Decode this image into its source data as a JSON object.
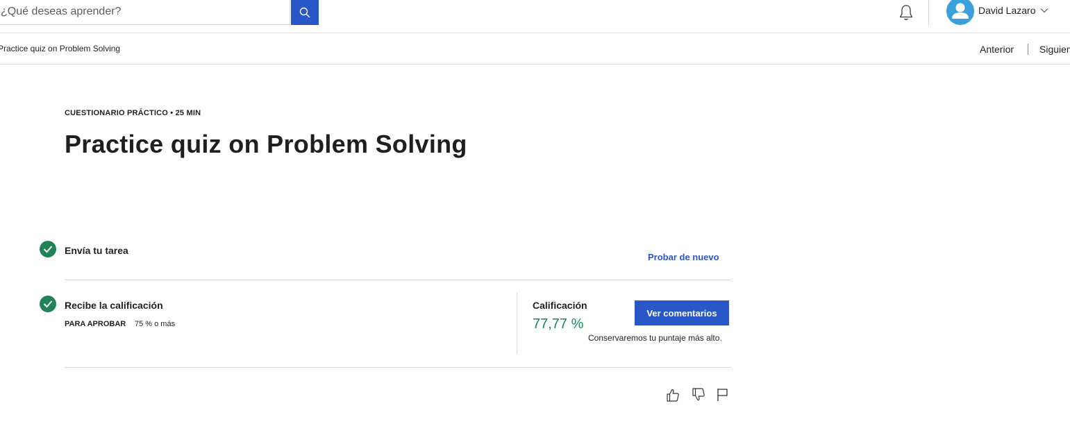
{
  "header": {
    "search": {
      "placeholder": "¿Qué deseas aprender?"
    },
    "user": {
      "name": "David Lazaro"
    }
  },
  "subnav": {
    "breadcrumb": "Practice quiz on Problem Solving",
    "prev_label": "Anterior",
    "next_label": "Siguiente"
  },
  "content": {
    "kicker": "CUESTIONARIO PRÁCTICO • 25 MIN",
    "title": "Practice quiz on Problem Solving",
    "step1": {
      "title": "Envía tu tarea",
      "action": "Probar de nuevo",
      "status": "completed"
    },
    "step2": {
      "title": "Recibe la calificación",
      "pass_label": "PARA APROBAR",
      "pass_value": "75 % o más",
      "grade_label": "Calificación",
      "grade_value": "77,77 %",
      "feedback_button": "Ver comentarios",
      "note": "Conservaremos tu puntaje más alto.",
      "status": "completed"
    },
    "feedback_icons": [
      "thumbs-up-icon",
      "thumbs-down-icon",
      "flag-icon"
    ]
  },
  "colors": {
    "accent": "#2a57c7",
    "success": "#1f8354",
    "avatar": "#3aa0dc"
  }
}
